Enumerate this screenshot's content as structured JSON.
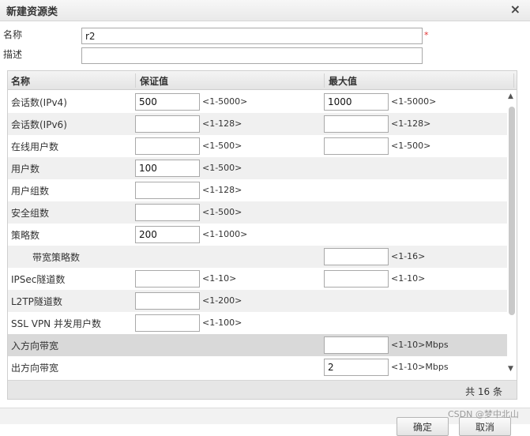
{
  "dialog": {
    "title": "新建资源类",
    "close_glyph": "×"
  },
  "form": {
    "name_label": "名称",
    "name_value": "r2",
    "required_mark": "*",
    "desc_label": "描述",
    "desc_value": ""
  },
  "table": {
    "headers": [
      "名称",
      "保证值",
      "最大值"
    ],
    "rows": [
      {
        "name": "会话数(IPv4)",
        "guarantee": "500",
        "guarantee_range": "<1-5000>",
        "max": "1000",
        "max_range": "<1-5000>"
      },
      {
        "name": "会话数(IPv6)",
        "guarantee": "",
        "guarantee_range": "<1-128>",
        "max": "",
        "max_range": "<1-128>"
      },
      {
        "name": "在线用户数",
        "guarantee": "",
        "guarantee_range": "<1-500>",
        "max": "",
        "max_range": "<1-500>"
      },
      {
        "name": "用户数",
        "guarantee": "100",
        "guarantee_range": "<1-500>"
      },
      {
        "name": "用户组数",
        "guarantee": "",
        "guarantee_range": "<1-128>"
      },
      {
        "name": "安全组数",
        "guarantee": "",
        "guarantee_range": "<1-500>"
      },
      {
        "name": "策略数",
        "guarantee": "200",
        "guarantee_range": "<1-1000>"
      },
      {
        "name": "带宽策略数",
        "max": "",
        "max_range": "<1-16>"
      },
      {
        "name": "IPSec隧道数",
        "guarantee": "",
        "guarantee_range": "<1-10>",
        "max": "",
        "max_range": "<1-10>"
      },
      {
        "name": "L2TP隧道数",
        "guarantee": "",
        "guarantee_range": "<1-200>"
      },
      {
        "name": "SSL VPN 并发用户数",
        "guarantee": "",
        "guarantee_range": "<1-100>"
      },
      {
        "name": "入方向带宽",
        "max": "",
        "max_range": "<1-10>Mbps"
      },
      {
        "name": "出方向带宽",
        "max": "2",
        "max_range": "<1-10>Mbps"
      }
    ],
    "footer_total": "共 16 条"
  },
  "buttons": {
    "ok": "确定",
    "cancel": "取消"
  },
  "watermark": "CSDN @梦中北山"
}
